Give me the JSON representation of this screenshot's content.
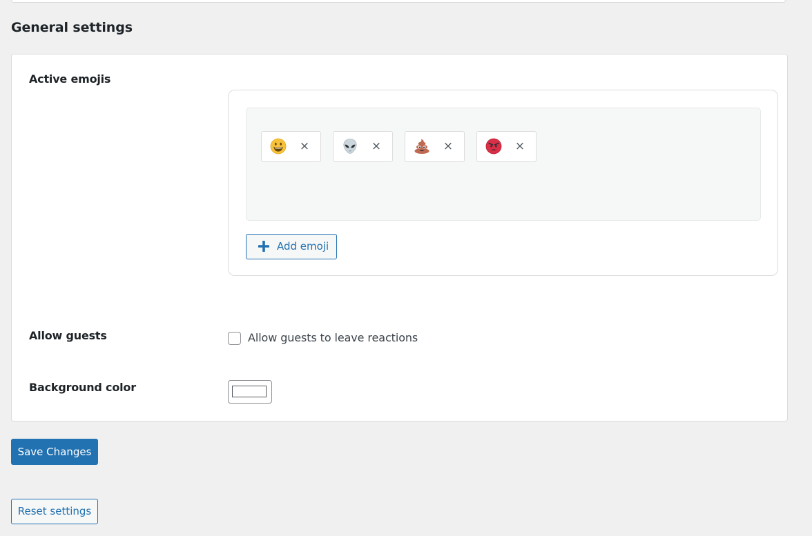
{
  "section": {
    "title": "General settings"
  },
  "active_emojis": {
    "label": "Active emojis",
    "items": [
      {
        "icon": "grinning-face-icon",
        "remove_label": "×"
      },
      {
        "icon": "alien-icon",
        "remove_label": "×"
      },
      {
        "icon": "pile-of-poo-icon",
        "remove_label": "×"
      },
      {
        "icon": "angry-face-icon",
        "remove_label": "×"
      }
    ],
    "add_button_label": "Add emoji"
  },
  "allow_guests": {
    "label": "Allow guests",
    "checkbox_label": "Allow guests to leave reactions",
    "checked": false
  },
  "background_color": {
    "label": "Background color",
    "value": "#ffffff"
  },
  "actions": {
    "save_label": "Save Changes",
    "reset_label": "Reset settings"
  },
  "colors": {
    "accent": "#2271b1",
    "page_background": "#f0f0f1"
  }
}
